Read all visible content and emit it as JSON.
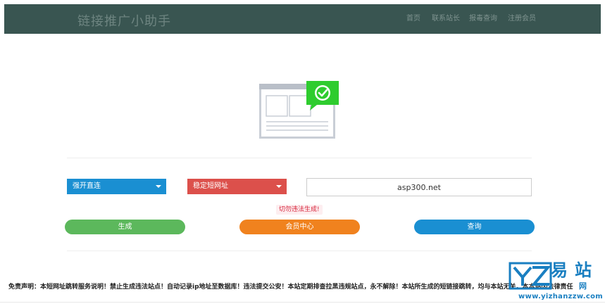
{
  "header": {
    "brand": "链接推广小助手",
    "nav": [
      "首页",
      "联系站长",
      "报毒查询",
      "注册会员"
    ]
  },
  "form": {
    "mode_select": "强开直连",
    "type_select": "稳定短网址",
    "url_value": "asp300.net",
    "warning": "切勿违法生成!"
  },
  "buttons": {
    "generate": "生成",
    "member": "会员中心",
    "query": "查询"
  },
  "footer": {
    "disclaimer": "免责声明：本短网址跳转服务说明！禁止生成违法站点！自动记录ip地址至数据库！违法提交公安！本站定期排查拉黑违规站点，永不解除！本站所生成的短链接跳转，均与本站无关，本本站因法律责任"
  },
  "watermark": {
    "big": "易站",
    "net": "网",
    "url": "www.yizhanzzw.com"
  },
  "colors": {
    "header_bg": "#395551",
    "blue": "#1a8fd2",
    "red": "#dc504b",
    "green": "#5cb85c",
    "orange": "#f0821e",
    "check_green": "#2ecc2e"
  }
}
